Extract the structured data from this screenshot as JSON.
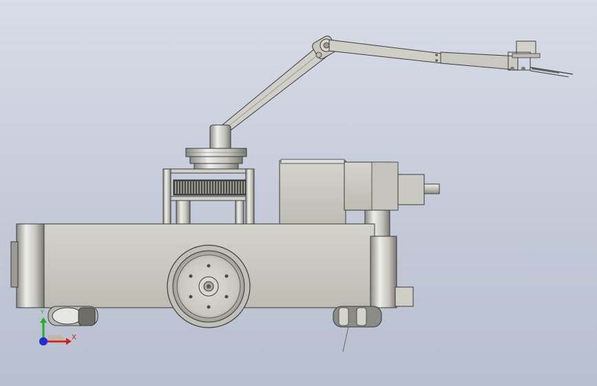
{
  "viewport": {
    "background_top": "#d7dce7",
    "background_bottom": "#b8bfcf"
  },
  "model": {
    "body_color": "#c9c9c1",
    "edge_color": "#3a3a3a",
    "shade_color": "#a9a9a1"
  },
  "triad": {
    "x_label": "X",
    "y_label": "Y",
    "x_color": "#d22020",
    "y_color": "#20b020",
    "z_color": "#2030d0"
  }
}
